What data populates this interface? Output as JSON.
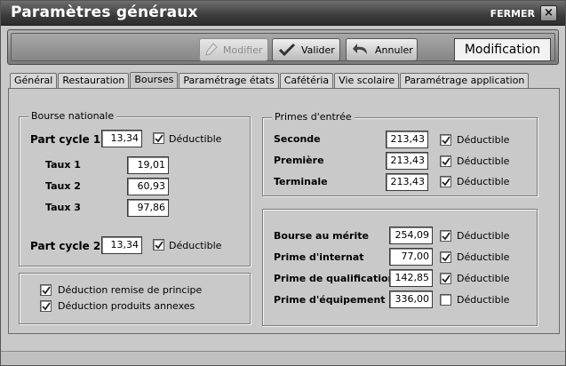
{
  "window": {
    "title": "Paramètres généraux",
    "close_label": "FERMER",
    "close_glyph": "×"
  },
  "toolbar": {
    "modifier": "Modifier",
    "valider": "Valider",
    "annuler": "Annuler",
    "mode": "Modification"
  },
  "tabs": [
    "Général",
    "Restauration",
    "Bourses",
    "Paramétrage états",
    "Cafétéria",
    "Vie scolaire",
    "Paramétrage application"
  ],
  "active_tab": "Bourses",
  "deductible_label": "Déductible",
  "bourse_nationale": {
    "legend": "Bourse nationale",
    "part_cycle_1": {
      "label": "Part cycle 1",
      "value": "13,34",
      "deductible": true
    },
    "taux": [
      {
        "label": "Taux 1",
        "value": "19,01"
      },
      {
        "label": "Taux 2",
        "value": "60,93"
      },
      {
        "label": "Taux 3",
        "value": "97,86"
      }
    ],
    "part_cycle_2": {
      "label": "Part cycle 2",
      "value": "13,34",
      "deductible": true
    }
  },
  "deductions": [
    {
      "label": "Déduction remise de principe",
      "checked": true
    },
    {
      "label": "Déduction produits annexes",
      "checked": true
    }
  ],
  "primes_entree": {
    "legend": "Primes d'entrée",
    "rows": [
      {
        "label": "Seconde",
        "value": "213,43",
        "deductible": true
      },
      {
        "label": "Première",
        "value": "213,43",
        "deductible": true
      },
      {
        "label": "Terminale",
        "value": "213,43",
        "deductible": true
      }
    ]
  },
  "primes_autres": [
    {
      "label": "Bourse au mérite",
      "value": "254,09",
      "deductible": true
    },
    {
      "label": "Prime d'internat",
      "value": "77,00",
      "deductible": true
    },
    {
      "label": "Prime de qualification",
      "value": "142,85",
      "deductible": true
    },
    {
      "label": "Prime d'équipement",
      "value": "336,00",
      "deductible": false
    }
  ]
}
